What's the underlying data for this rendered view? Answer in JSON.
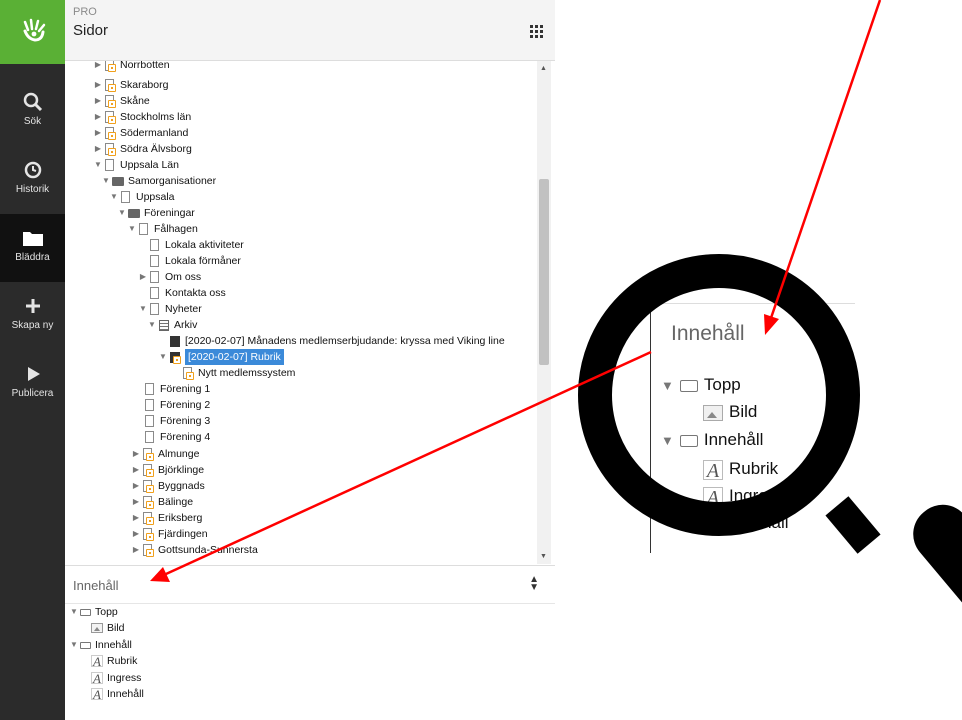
{
  "app": {
    "product": "PRO",
    "section": "Sidor"
  },
  "rail": [
    {
      "label": "Sök",
      "icon": "search-icon"
    },
    {
      "label": "Historik",
      "icon": "history-icon"
    },
    {
      "label": "Bläddra",
      "icon": "folder-icon"
    },
    {
      "label": "Skapa ny",
      "icon": "plus-icon"
    },
    {
      "label": "Publicera",
      "icon": "play-icon"
    }
  ],
  "tree": [
    {
      "label": "Norrbotten"
    },
    {
      "label": "Skaraborg"
    },
    {
      "label": "Skåne"
    },
    {
      "label": "Stockholms län"
    },
    {
      "label": "Södermanland"
    },
    {
      "label": "Södra Älvsborg"
    },
    {
      "label": "Uppsala Län"
    },
    {
      "label": "Samorganisationer"
    },
    {
      "label": "Uppsala"
    },
    {
      "label": "Föreningar"
    },
    {
      "label": "Fålhagen"
    },
    {
      "label": "Lokala aktiviteter"
    },
    {
      "label": "Lokala förmåner"
    },
    {
      "label": "Om oss"
    },
    {
      "label": "Kontakta oss"
    },
    {
      "label": "Nyheter"
    },
    {
      "label": "Arkiv"
    },
    {
      "label": "[2020-02-07] Månadens medlemserbjudande: kryssa med Viking line"
    },
    {
      "label": "[2020-02-07] Rubrik"
    },
    {
      "label": "Nytt medlemssystem"
    },
    {
      "label": "Förening 1"
    },
    {
      "label": "Förening 2"
    },
    {
      "label": "Förening 3"
    },
    {
      "label": "Förening 4"
    },
    {
      "label": "Almunge"
    },
    {
      "label": "Björklinge"
    },
    {
      "label": "Byggnads"
    },
    {
      "label": "Bälinge"
    },
    {
      "label": "Eriksberg"
    },
    {
      "label": "Fjärdingen"
    },
    {
      "label": "Gottsunda-Sunnersta"
    }
  ],
  "content": {
    "title": "Innehåll",
    "items": [
      {
        "label": "Topp"
      },
      {
        "label": "Bild"
      },
      {
        "label": "Innehåll"
      },
      {
        "label": "Rubrik"
      },
      {
        "label": "Ingress"
      },
      {
        "label": "Innehåll"
      }
    ]
  },
  "zoom": {
    "title": "Innehåll",
    "items": [
      "Topp",
      "Bild",
      "Innehåll",
      "Rubrik",
      "Ingress",
      "Innehåll"
    ]
  },
  "colors": {
    "brand": "#5ab035",
    "selection": "#3b8ad9",
    "arrow": "#ff0000"
  }
}
